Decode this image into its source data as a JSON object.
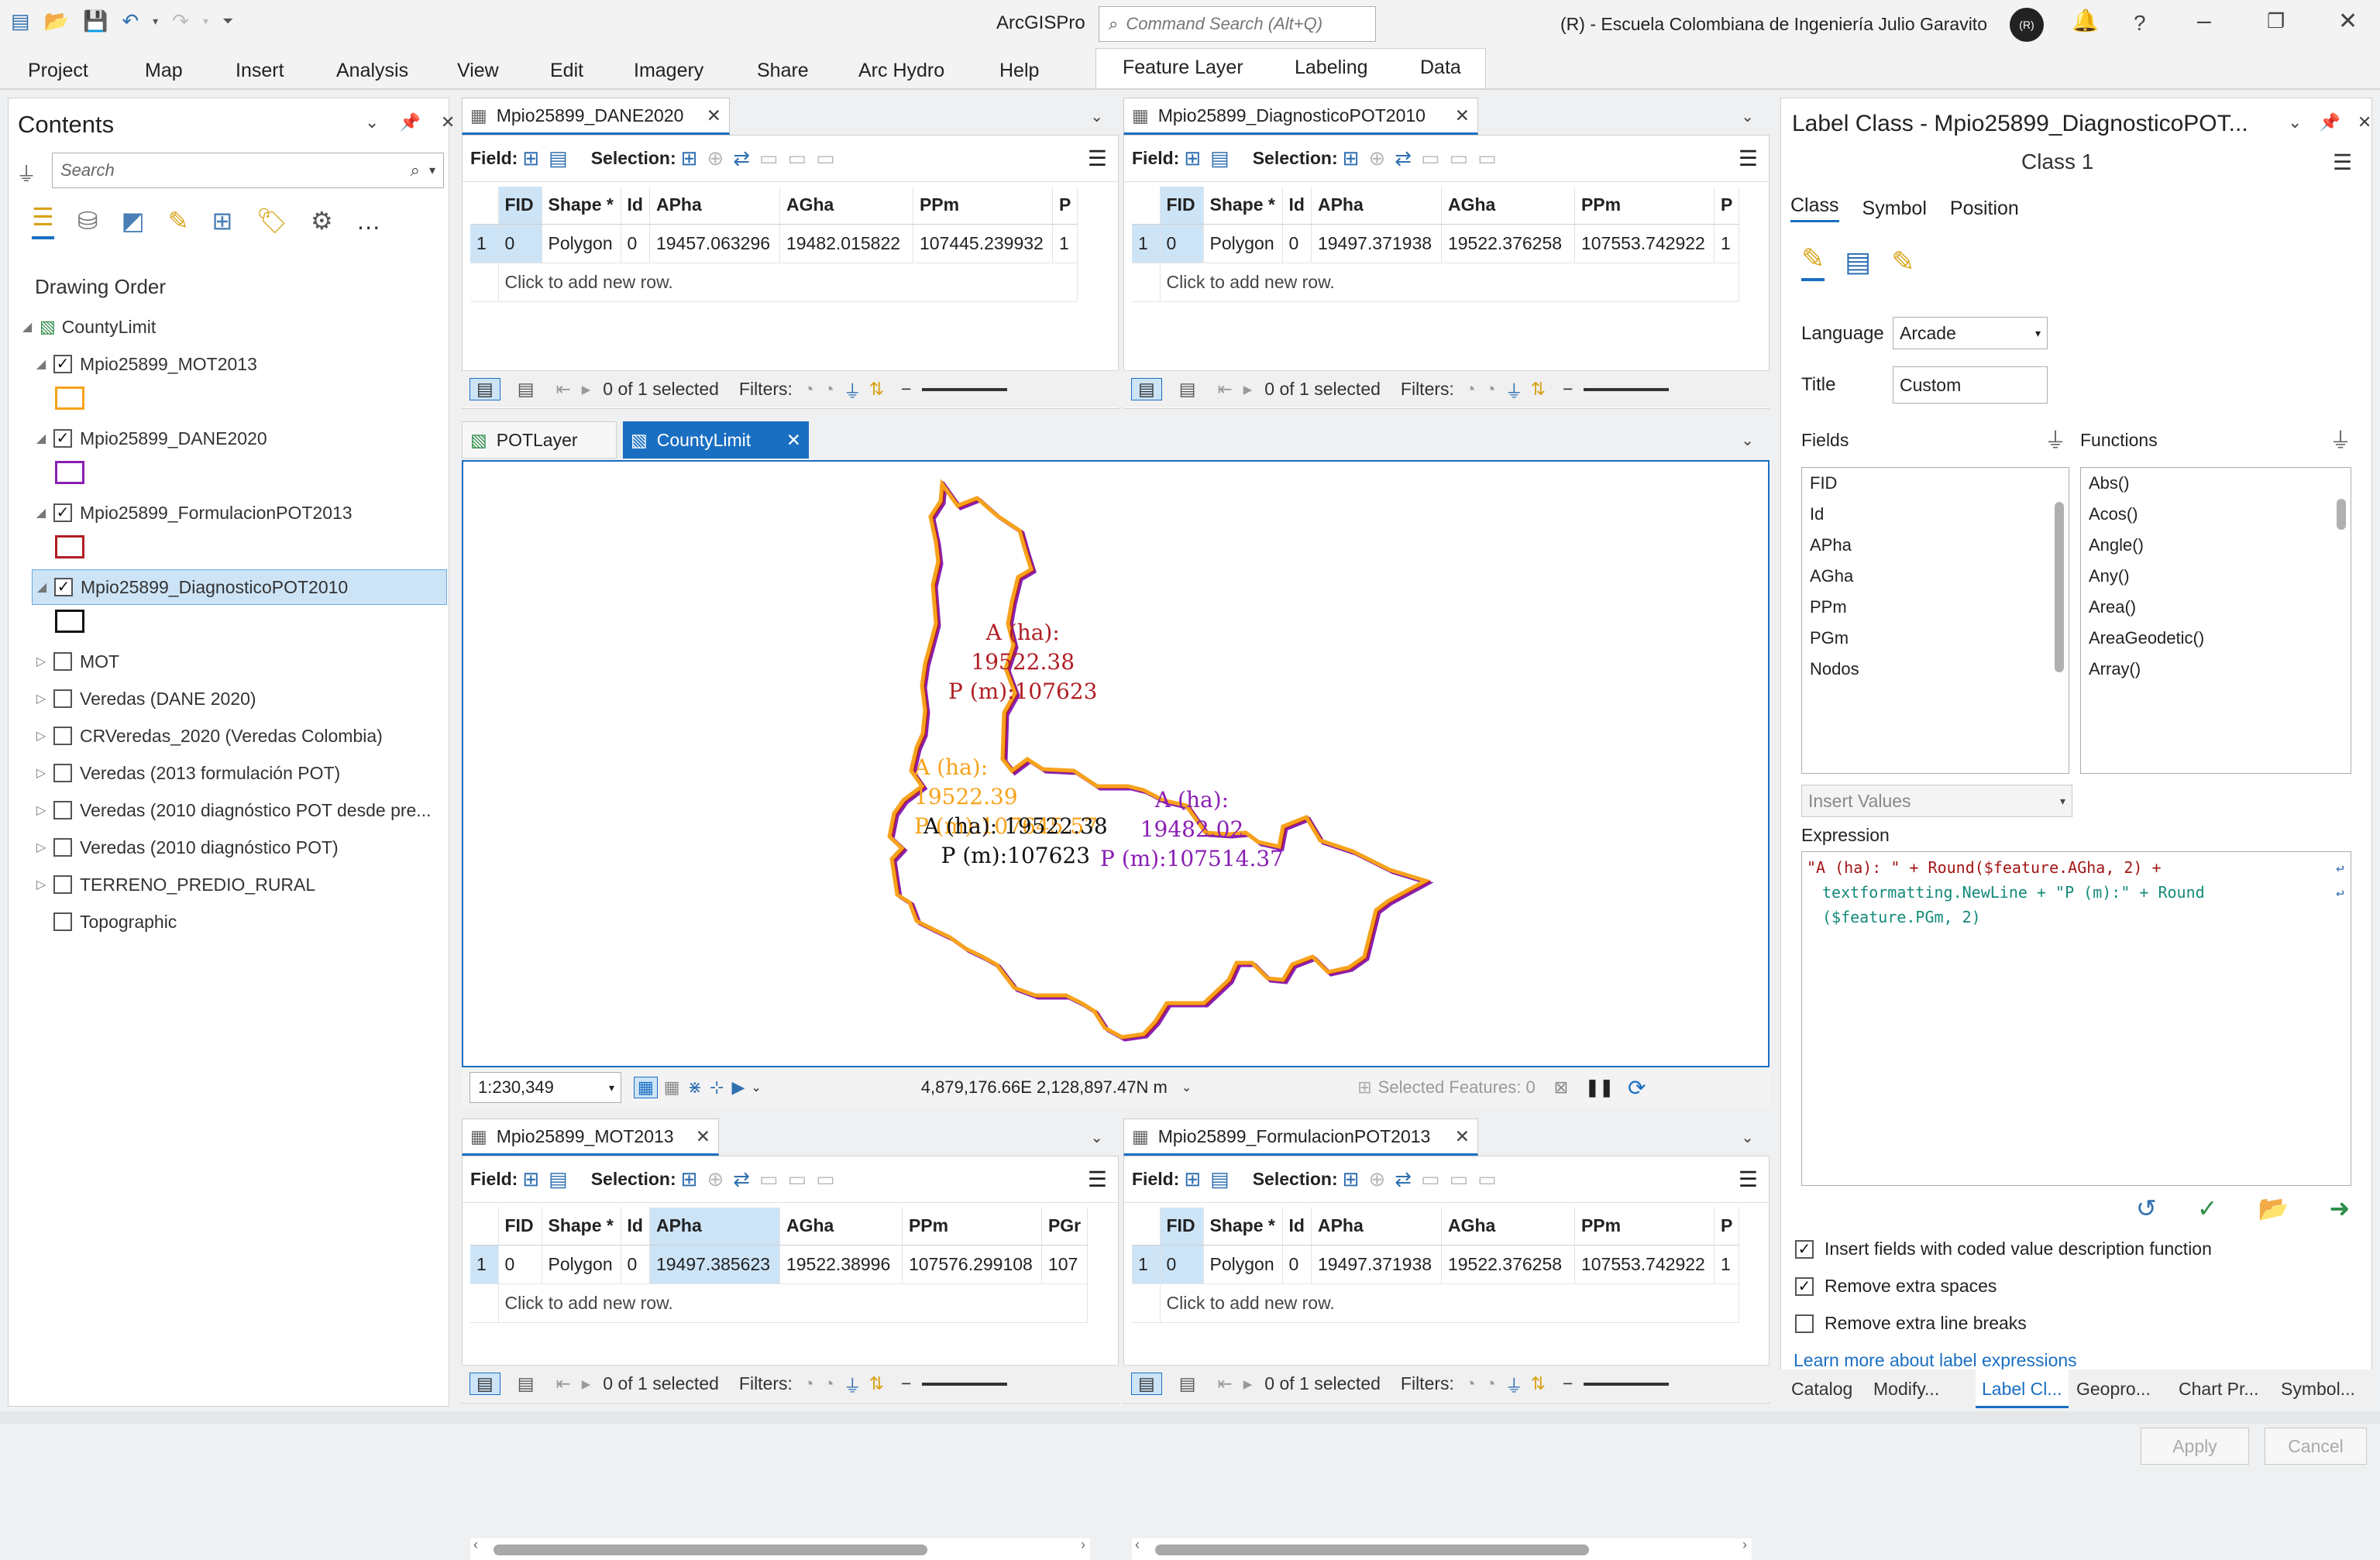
{
  "app": {
    "title": "ArcGISPro",
    "search_placeholder": "Command Search (Alt+Q)",
    "org": "(R) - Escuela Colombiana de Ingeniería Julio Garavito",
    "avatar_initials": "(R)"
  },
  "ribbon": {
    "tabs": [
      "Project",
      "Map",
      "Insert",
      "Analysis",
      "View",
      "Edit",
      "Imagery",
      "Share",
      "Arc Hydro",
      "Help"
    ],
    "context_tabs": [
      "Feature Layer",
      "Labeling",
      "Data"
    ]
  },
  "contents": {
    "title": "Contents",
    "search_placeholder": "Search",
    "heading": "Drawing Order",
    "map_name": "CountyLimit",
    "layers": [
      {
        "name": "Mpio25899_MOT2013",
        "checked": true,
        "swatch": "#f7a21b"
      },
      {
        "name": "Mpio25899_DANE2020",
        "checked": true,
        "swatch": "#8a1fb3"
      },
      {
        "name": "Mpio25899_FormulacionPOT2013",
        "checked": true,
        "swatch": "#b01e24"
      },
      {
        "name": "Mpio25899_DiagnosticoPOT2010",
        "checked": true,
        "swatch": "#111111",
        "selected": true
      },
      {
        "name": "MOT",
        "checked": false
      },
      {
        "name": "Veredas (DANE 2020)",
        "checked": false
      },
      {
        "name": "CRVeredas_2020 (Veredas Colombia)",
        "checked": false
      },
      {
        "name": "Veredas (2013 formulación POT)",
        "checked": false
      },
      {
        "name": "Veredas (2010 diagnóstico POT desde pre...",
        "checked": false
      },
      {
        "name": "Veredas (2010 diagnóstico POT)",
        "checked": false
      },
      {
        "name": "TERRENO_PREDIO_RURAL",
        "checked": false
      },
      {
        "name": "Topographic",
        "checked": false
      }
    ]
  },
  "tables": {
    "field_label": "Field:",
    "selection_label": "Selection:",
    "click_to_add": "Click to add new row.",
    "selected_text": "0 of 1 selected",
    "filters_label": "Filters:",
    "top_left": {
      "title": "Mpio25899_DANE2020",
      "columns": [
        "FID",
        "Shape *",
        "Id",
        "APha",
        "AGha",
        "PPm",
        "P"
      ],
      "row": [
        "1",
        "0",
        "Polygon",
        "0",
        "19457.063296",
        "19482.015822",
        "107445.239932",
        "1"
      ]
    },
    "top_right": {
      "title": "Mpio25899_DiagnosticoPOT2010",
      "columns": [
        "FID",
        "Shape *",
        "Id",
        "APha",
        "AGha",
        "PPm",
        "P"
      ],
      "row": [
        "1",
        "0",
        "Polygon",
        "0",
        "19497.371938",
        "19522.376258",
        "107553.742922",
        "1"
      ]
    },
    "bottom_left": {
      "title": "Mpio25899_MOT2013",
      "columns": [
        "FID",
        "Shape *",
        "Id",
        "APha",
        "AGha",
        "PPm",
        "PGr"
      ],
      "row": [
        "1",
        "0",
        "Polygon",
        "0",
        "19497.385623",
        "19522.38996",
        "107576.299108",
        "107"
      ]
    },
    "bottom_right": {
      "title": "Mpio25899_FormulacionPOT2013",
      "columns": [
        "FID",
        "Shape *",
        "Id",
        "APha",
        "AGha",
        "PPm",
        "P"
      ],
      "row": [
        "1",
        "0",
        "Polygon",
        "0",
        "19497.371938",
        "19522.376258",
        "107553.742922",
        "1"
      ]
    }
  },
  "map": {
    "tabs": [
      "POTLayer",
      "CountyLimit"
    ],
    "labels": {
      "red": "A (ha):\n19522.38\nP (m):107623",
      "orange": "A (ha):\n19522.39\nP (m):107645.57",
      "black": "A (ha): 19522.38\nP (m):107623",
      "purple": "A (ha):\n19482.02\nP (m):107514.37"
    },
    "label_colors": {
      "red": "#b01e24",
      "orange": "#f7a21b",
      "black": "#111111",
      "purple": "#8a1fb3"
    },
    "scale": "1:230,349",
    "coords": "4,879,176.66E 2,128,897.47N m",
    "selected_features": "Selected Features: 0"
  },
  "label_class": {
    "title": "Label Class - Mpio25899_DiagnosticoPOT...",
    "class_name": "Class 1",
    "tabs": [
      "Class",
      "Symbol",
      "Position"
    ],
    "language_label": "Language",
    "language_value": "Arcade",
    "title_label": "Title",
    "title_value": "Custom",
    "fields_label": "Fields",
    "functions_label": "Functions",
    "fields": [
      "FID",
      "Id",
      "APha",
      "AGha",
      "PPm",
      "PGm",
      "Nodos"
    ],
    "functions": [
      "Abs()",
      "Acos()",
      "Angle()",
      "Any()",
      "Area()",
      "AreaGeodetic()",
      "Array()"
    ],
    "insert_values": "Insert Values",
    "expression_label": "Expression",
    "expression_line1": "\"A (ha): \" + Round($feature.AGha, 2) +",
    "expression_line2": "textformatting.NewLine + \"P (m):\" + Round",
    "expression_line3": "($feature.PGm, 2)",
    "options": [
      {
        "label": "Insert fields with coded value description function",
        "checked": true
      },
      {
        "label": "Remove extra spaces",
        "checked": true
      },
      {
        "label": "Remove extra line breaks",
        "checked": false
      }
    ],
    "learn_more": "Learn more about label expressions",
    "apply": "Apply",
    "cancel": "Cancel"
  },
  "bottom_tabs": [
    "Catalog",
    "Modify...",
    "Label Cl...",
    "Geopro...",
    "Chart Pr...",
    "Symbol..."
  ]
}
